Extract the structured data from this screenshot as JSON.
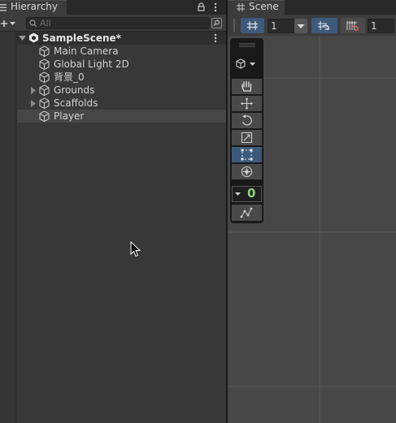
{
  "hierarchy": {
    "tab_title": "Hierarchy",
    "search_placeholder": "All",
    "scene_name": "SampleScene*",
    "items": [
      {
        "label": "Main Camera"
      },
      {
        "label": "Global Light 2D"
      },
      {
        "label": "背景_0"
      },
      {
        "label": "Grounds"
      },
      {
        "label": "Scaffolds"
      },
      {
        "label": "Player"
      }
    ]
  },
  "scene_view": {
    "tab_title": "Scene",
    "grid_size_value": "1",
    "snap_increment_value": "1",
    "overlay": {
      "tools": [
        "hand-tool",
        "move-tool",
        "rotate-tool",
        "scale-tool",
        "rect-tool",
        "transform-tool"
      ],
      "active_tool": "rect-tool",
      "custom_tool_value": "0"
    }
  },
  "colors": {
    "panel_bg": "#383838",
    "scene_bg": "#474747",
    "active_tool": "#3d5a7c",
    "selected_row": "#464646",
    "accent_green": "#8fd37a"
  }
}
